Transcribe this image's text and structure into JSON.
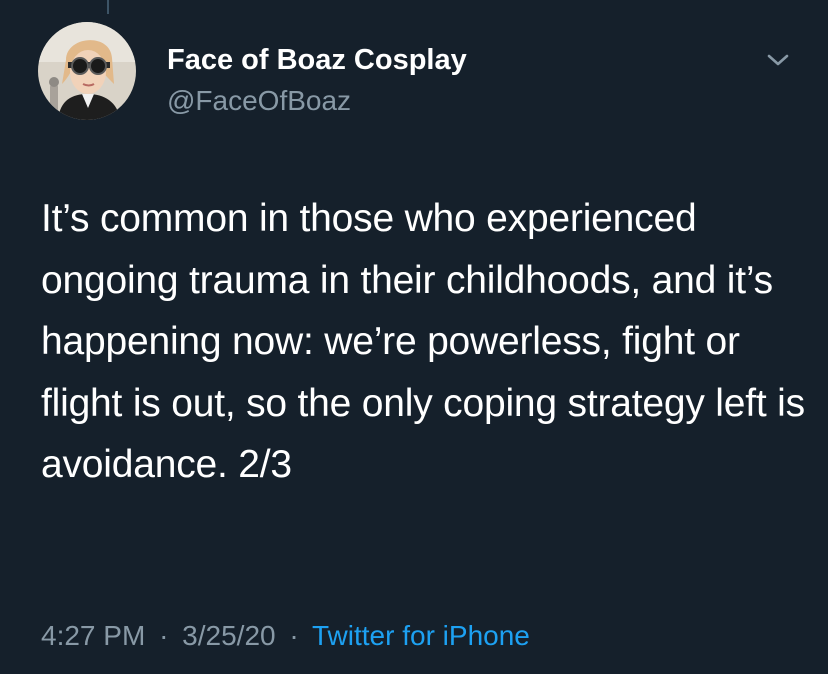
{
  "tweet": {
    "display_name": "Face of Boaz Cosplay",
    "handle": "@FaceOfBoaz",
    "text": "It’s common in those who experienced ongoing trauma in their childhoods, and it’s happening now: we’re powerless, fight or flight is out, so the only coping strategy left is avoidance. 2/3",
    "time": "4:27 PM",
    "date": "3/25/20",
    "separator": "·",
    "source": "Twitter for iPhone"
  },
  "icons": {
    "avatar": "profile-photo-avatar",
    "menu": "chevron-down-icon"
  },
  "colors": {
    "background": "#15202b",
    "text": "#ffffff",
    "secondary_text": "#8899a6",
    "link": "#1da1f2"
  }
}
